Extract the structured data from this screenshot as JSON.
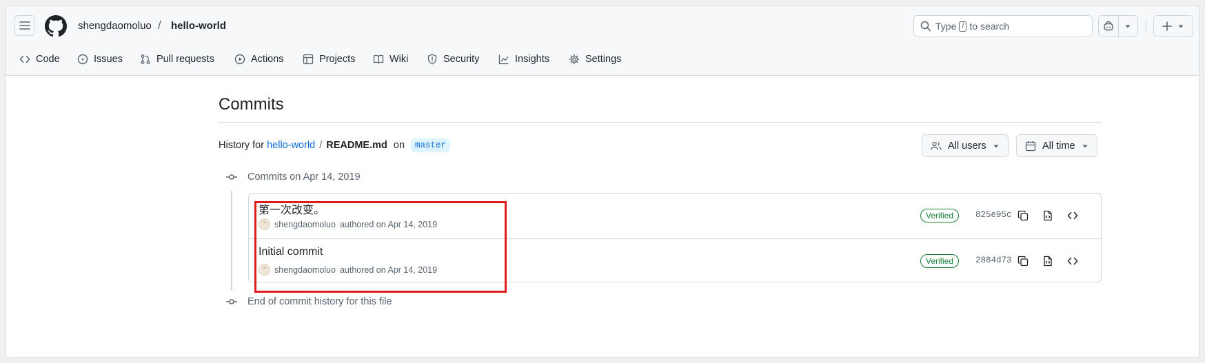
{
  "header": {
    "owner": "shengdaomoluo",
    "separator": "/",
    "repo": "hello-world",
    "search": {
      "prefix": "Type",
      "key": "/",
      "suffix": "to search"
    }
  },
  "tabs": [
    {
      "label": "Code",
      "icon": "code-icon"
    },
    {
      "label": "Issues",
      "icon": "issue-opened-icon"
    },
    {
      "label": "Pull requests",
      "icon": "git-pull-request-icon"
    },
    {
      "label": "Actions",
      "icon": "play-icon"
    },
    {
      "label": "Projects",
      "icon": "table-icon"
    },
    {
      "label": "Wiki",
      "icon": "book-icon"
    },
    {
      "label": "Security",
      "icon": "shield-icon"
    },
    {
      "label": "Insights",
      "icon": "graph-icon"
    },
    {
      "label": "Settings",
      "icon": "gear-icon"
    }
  ],
  "page": {
    "title": "Commits",
    "history_prefix": "History for",
    "history_repo": "hello-world",
    "history_sep": "/",
    "history_file": "README.md",
    "history_on": "on",
    "branch": "master",
    "filters": {
      "users": "All users",
      "time": "All time"
    }
  },
  "timeline": {
    "group_label": "Commits on Apr 14, 2019",
    "end_label": "End of commit history for this file"
  },
  "commits": [
    {
      "title": "第一次改变。",
      "author": "shengdaomoluo",
      "authored_text": "authored on Apr 14, 2019",
      "badge": "Verified",
      "sha": "825e95c"
    },
    {
      "title": "Initial commit",
      "author": "shengdaomoluo",
      "authored_text": "authored on Apr 14, 2019",
      "badge": "Verified",
      "sha": "2884d73"
    }
  ],
  "colors": {
    "accent": "#0969da",
    "verified": "#1a7f37",
    "highlight": "#e01b1b",
    "border": "#d1d9e0"
  }
}
